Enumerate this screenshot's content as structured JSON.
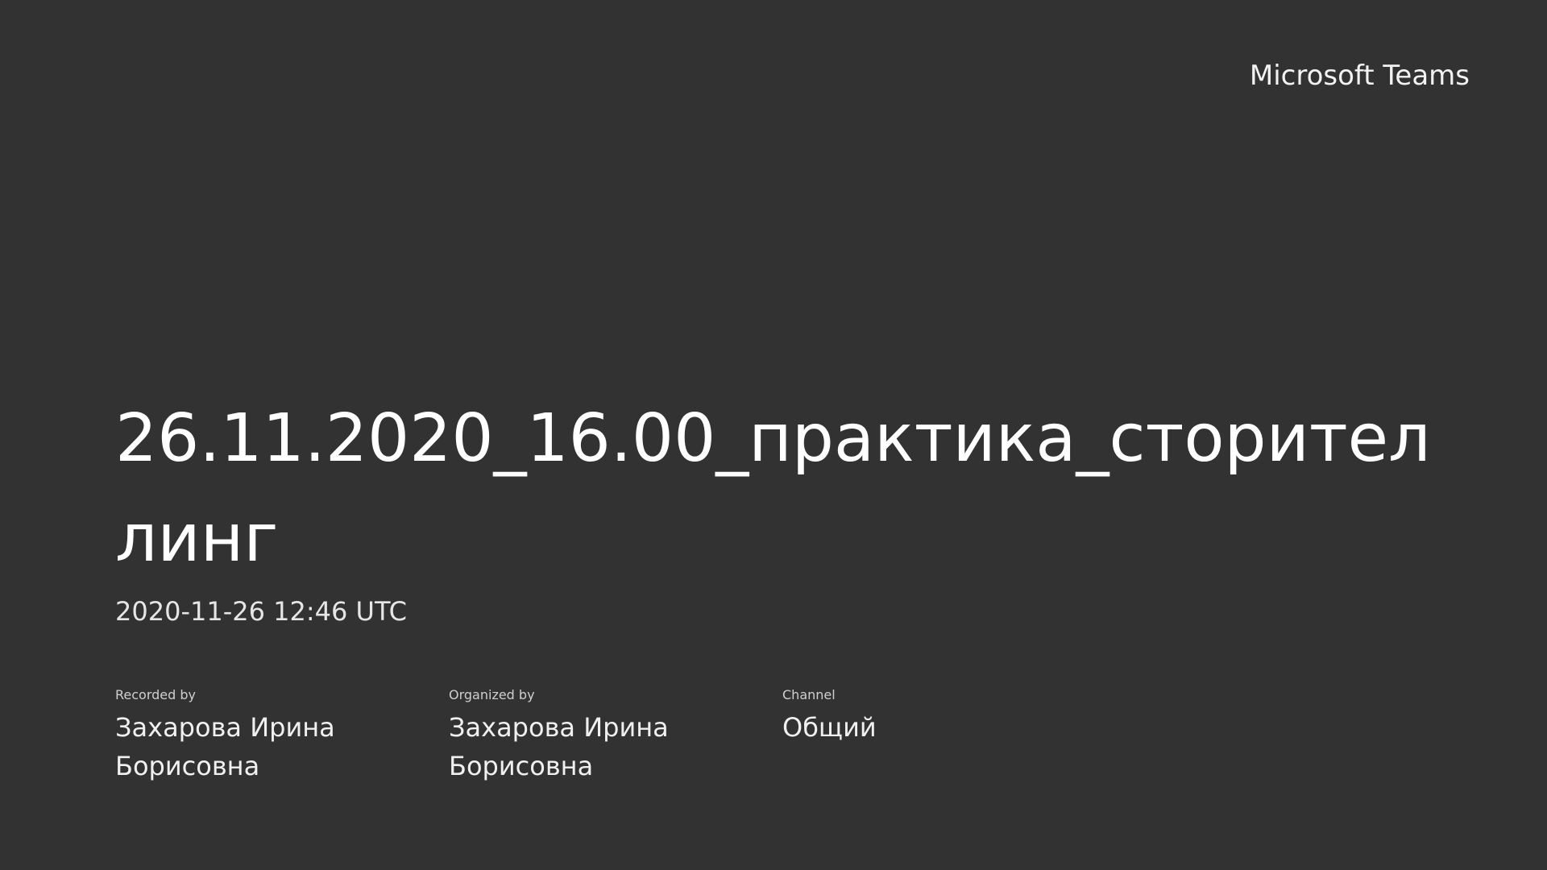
{
  "brand": "Microsoft Teams",
  "meeting": {
    "title": "26.11.2020_16.00_практика_сторителлинг",
    "timestamp": "2020-11-26 12:46 UTC"
  },
  "details": [
    {
      "label": "Recorded by",
      "value": "Захарова Ирина Борисовна"
    },
    {
      "label": "Organized by",
      "value": "Захарова Ирина Борисовна"
    },
    {
      "label": "Channel",
      "value": "Общий"
    }
  ],
  "colors": {
    "background": "#323232",
    "text": "#ffffff"
  }
}
